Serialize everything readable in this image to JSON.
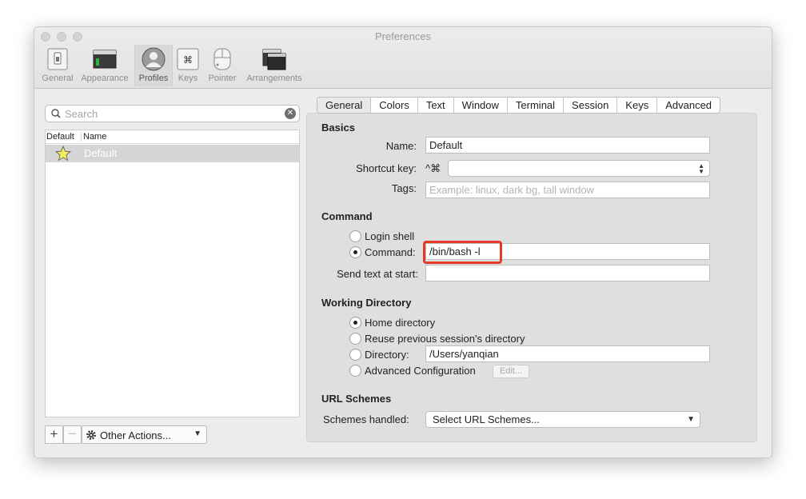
{
  "window": {
    "title": "Preferences"
  },
  "toolbar": {
    "items": [
      {
        "label": "General"
      },
      {
        "label": "Appearance"
      },
      {
        "label": "Profiles"
      },
      {
        "label": "Keys"
      },
      {
        "label": "Pointer"
      },
      {
        "label": "Arrangements"
      }
    ],
    "selected": "Profiles"
  },
  "sidebar": {
    "search_placeholder": "Search",
    "list_headers": {
      "default": "Default",
      "name": "Name"
    },
    "profiles": [
      {
        "name": "Default",
        "is_default": true
      }
    ],
    "add_label": "+",
    "remove_label": "−",
    "other_actions_label": "Other Actions..."
  },
  "tabs": [
    "General",
    "Colors",
    "Text",
    "Window",
    "Terminal",
    "Session",
    "Keys",
    "Advanced"
  ],
  "active_tab": "General",
  "basics": {
    "title": "Basics",
    "name_label": "Name:",
    "name_value": "Default",
    "shortcut_label": "Shortcut key:",
    "shortcut_prefix": "^⌘",
    "tags_label": "Tags:",
    "tags_placeholder": "Example: linux, dark bg, tall window"
  },
  "command": {
    "title": "Command",
    "login_shell_label": "Login shell",
    "command_label": "Command:",
    "command_value": "/bin/bash -l",
    "send_text_label": "Send text at start:",
    "selected": "Command"
  },
  "working_directory": {
    "title": "Working Directory",
    "home_label": "Home directory",
    "reuse_label": "Reuse previous session's directory",
    "directory_label": "Directory:",
    "directory_value": "/Users/yanqian",
    "advanced_label": "Advanced Configuration",
    "edit_label": "Edit...",
    "selected": "Home directory"
  },
  "url_schemes": {
    "title": "URL Schemes",
    "schemes_label": "Schemes handled:",
    "schemes_value": "Select URL Schemes..."
  },
  "colors": {
    "highlight": "#e53a2a",
    "selected_row": "#d5d5d5"
  }
}
